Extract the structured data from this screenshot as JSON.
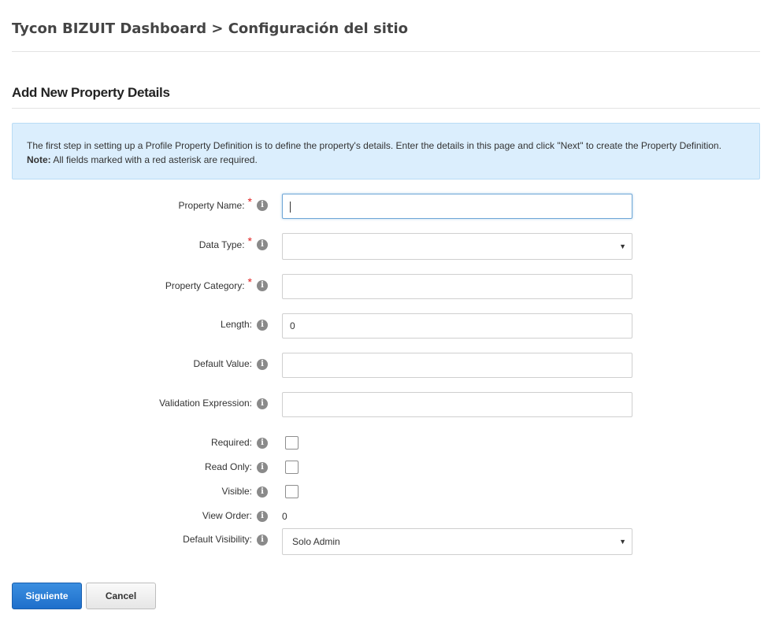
{
  "header": {
    "title": "Tycon BIZUIT Dashboard > Configuración del sitio"
  },
  "section": {
    "title": "Add New Property Details"
  },
  "info": {
    "text": "The first step in setting up a Profile Property Definition is to define the property's details. Enter the details in this page and click \"Next\" to create the Property Definition.",
    "note_label": "Note:",
    "note_text": " All fields marked with a red asterisk are required."
  },
  "form": {
    "required_marker": "*",
    "info_glyph": "i",
    "property_name": {
      "label": "Property Name:",
      "value": ""
    },
    "data_type": {
      "label": "Data Type:",
      "value": ""
    },
    "property_category": {
      "label": "Property Category:",
      "value": ""
    },
    "length": {
      "label": "Length:",
      "value": "0"
    },
    "default_value": {
      "label": "Default Value:",
      "value": ""
    },
    "validation_expression": {
      "label": "Validation Expression:",
      "value": ""
    },
    "required": {
      "label": "Required:",
      "checked": false
    },
    "read_only": {
      "label": "Read Only:",
      "checked": false
    },
    "visible": {
      "label": "Visible:",
      "checked": false
    },
    "view_order": {
      "label": "View Order:",
      "value": "0"
    },
    "default_visibility": {
      "label": "Default Visibility:",
      "value": "Solo Admin"
    },
    "select_arrow": "▼"
  },
  "buttons": {
    "next": "Siguiente",
    "cancel": "Cancel"
  },
  "colors": {
    "primary": "#2a7fd8",
    "info_bg": "#dbeefd",
    "required": "#e02020"
  }
}
